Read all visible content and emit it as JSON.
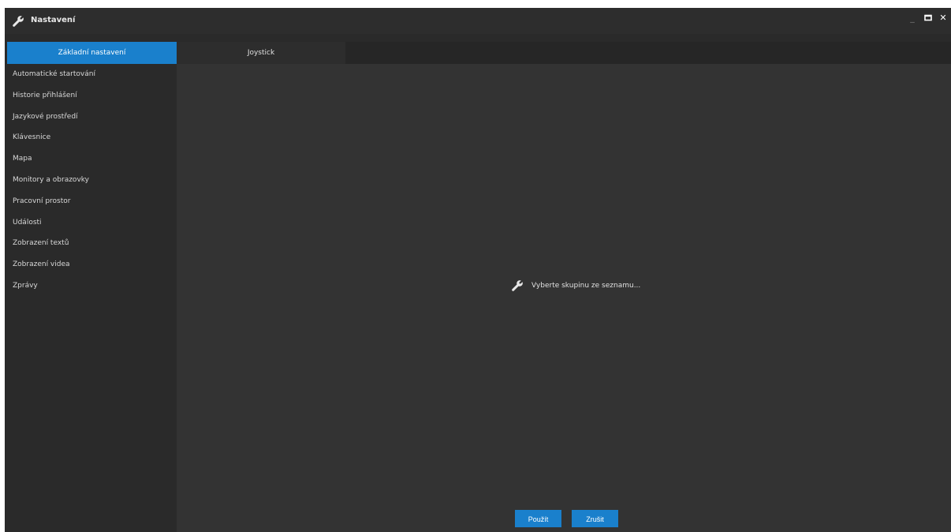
{
  "window": {
    "title": "Nastavení",
    "icon": "wrench-icon",
    "controls": {
      "minimize": "_",
      "maximize": "□",
      "close": "✕"
    }
  },
  "tabs": [
    {
      "label": "Základní nastavení",
      "active": true
    },
    {
      "label": "Joystick",
      "active": false
    }
  ],
  "sidebar": {
    "items": [
      {
        "label": "Automatické startování"
      },
      {
        "label": "Historie přihlášení"
      },
      {
        "label": "Jazykové prostředí"
      },
      {
        "label": "Klávesnice"
      },
      {
        "label": "Mapa"
      },
      {
        "label": "Monitory a obrazovky"
      },
      {
        "label": "Pracovní prostor"
      },
      {
        "label": "Události"
      },
      {
        "label": "Zobrazení textů"
      },
      {
        "label": "Zobrazení videa"
      },
      {
        "label": "Zprávy"
      }
    ]
  },
  "main": {
    "placeholder": "Vyberte skupinu ze seznamu...",
    "placeholder_icon": "wrench-icon"
  },
  "footer": {
    "apply_label": "Použít",
    "cancel_label": "Zrušit"
  },
  "colors": {
    "accent": "#1a80cc",
    "background": "#333333",
    "sidebar": "#2a2a2a"
  }
}
